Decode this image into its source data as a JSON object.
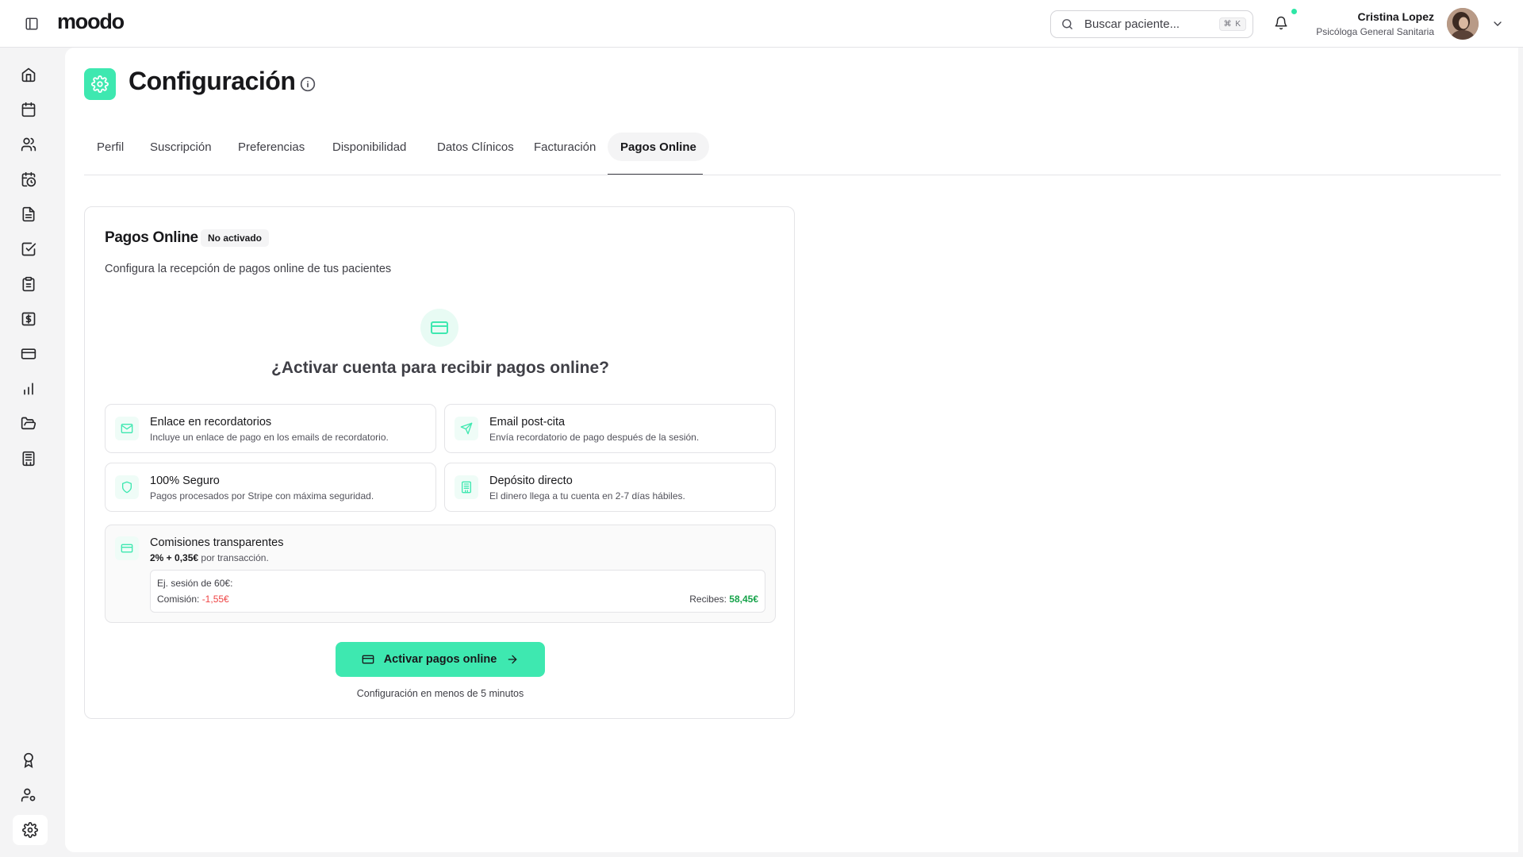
{
  "app": {
    "logo": "moodo"
  },
  "header": {
    "search_placeholder": "Buscar paciente...",
    "search_shortcut": "⌘ K",
    "user_name": "Cristina Lopez",
    "user_role": "Psicóloga General Sanitaria",
    "notification_dot_color": "#2ee6a6"
  },
  "sidebar": {
    "items": [
      {
        "icon": "home-icon"
      },
      {
        "icon": "calendar-icon"
      },
      {
        "icon": "users-icon"
      },
      {
        "icon": "calendar-clock-icon"
      },
      {
        "icon": "file-text-icon"
      },
      {
        "icon": "check-square-icon"
      },
      {
        "icon": "clipboard-icon"
      },
      {
        "icon": "dollar-icon"
      },
      {
        "icon": "credit-card-icon"
      },
      {
        "icon": "bar-chart-icon"
      },
      {
        "icon": "folder-open-icon"
      },
      {
        "icon": "building-icon"
      }
    ],
    "bottom_items": [
      {
        "icon": "award-icon"
      },
      {
        "icon": "user-settings-icon"
      },
      {
        "icon": "gear-icon",
        "active": true
      }
    ]
  },
  "page": {
    "title": "Configuración",
    "tabs": [
      {
        "label": "Perfil"
      },
      {
        "label": "Suscripción"
      },
      {
        "label": "Preferencias"
      },
      {
        "label": "Disponibilidad"
      },
      {
        "label": "Datos Clínicos"
      },
      {
        "label": "Facturación"
      },
      {
        "label": "Pagos Online",
        "active": true
      }
    ]
  },
  "card": {
    "title": "Pagos Online",
    "badge": "No activado",
    "description": "Configura la recepción de pagos online de tus pacientes",
    "hero_title": "¿Activar cuenta para recibir pagos online?",
    "features": [
      {
        "title": "Enlace en recordatorios",
        "description": "Incluye un enlace de pago en los emails de recordatorio.",
        "icon": "mail-icon"
      },
      {
        "title": "Email post-cita",
        "description": "Envía recordatorio de pago después de la sesión.",
        "icon": "send-icon"
      },
      {
        "title": "100% Seguro",
        "description": "Pagos procesados por Stripe con máxima seguridad.",
        "icon": "shield-icon"
      },
      {
        "title": "Depósito directo",
        "description": "El dinero llega a tu cuenta en 2-7 días hábiles.",
        "icon": "bank-icon"
      }
    ],
    "fees": {
      "title": "Comisiones transparentes",
      "rate": "2% + 0,35€",
      "rate_suffix": " por transacción.",
      "example_label": "Ej. sesión de 60€:",
      "commission_label": "Comisión: ",
      "commission_value": "-1,55€",
      "receive_label": "Recibes: ",
      "receive_value": "58,45€"
    },
    "cta_label": "Activar pagos online",
    "cta_note": "Configuración en menos de 5 minutos"
  },
  "colors": {
    "accent": "#3ee8b0",
    "accent_soft": "#e8fbf4",
    "negative": "#ef4444",
    "positive": "#16a34a"
  }
}
